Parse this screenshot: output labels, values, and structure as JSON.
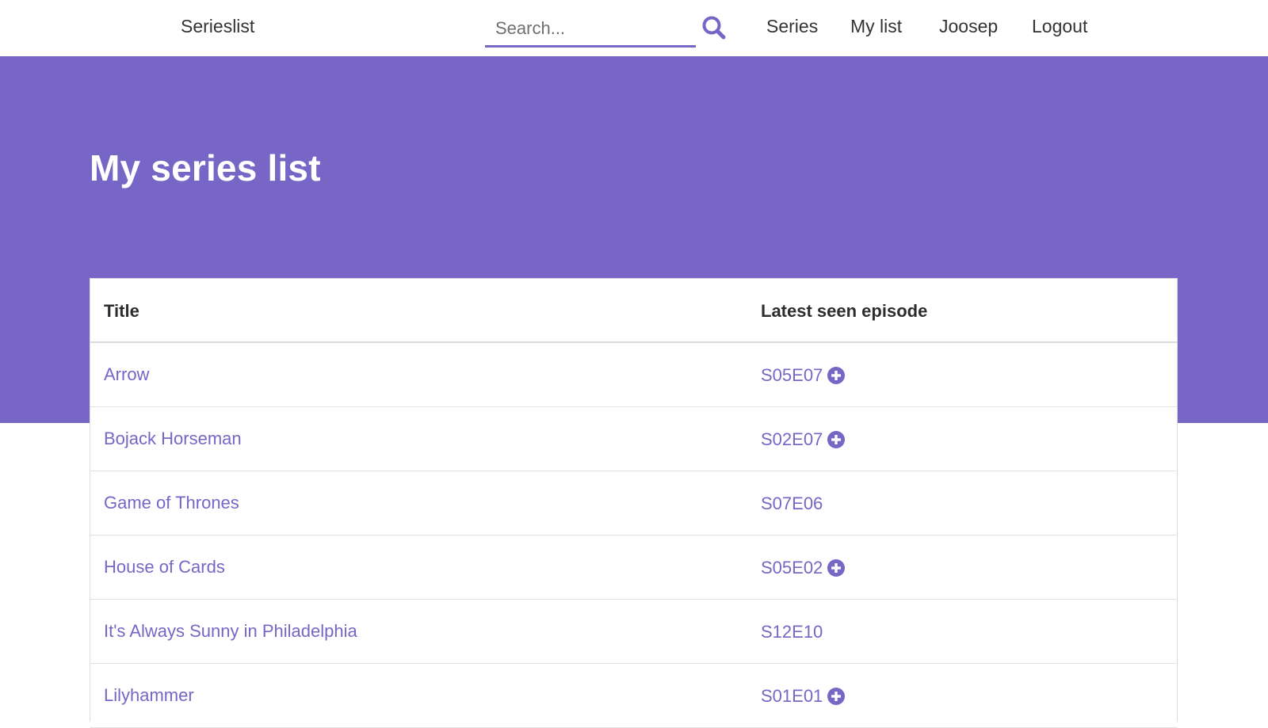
{
  "nav": {
    "brand": "Serieslist",
    "search_placeholder": "Search...",
    "search_value": "",
    "links": [
      {
        "label": "Series"
      },
      {
        "label": "My list"
      },
      {
        "label": "Joosep"
      },
      {
        "label": "Logout"
      }
    ]
  },
  "hero": {
    "title": "My series list"
  },
  "table": {
    "headers": {
      "title": "Title",
      "episode": "Latest seen episode"
    },
    "rows": [
      {
        "title": "Arrow",
        "episode": "S05E07",
        "has_add": true
      },
      {
        "title": "Bojack Horseman",
        "episode": "S02E07",
        "has_add": true
      },
      {
        "title": "Game of Thrones",
        "episode": "S07E06",
        "has_add": false
      },
      {
        "title": "House of Cards",
        "episode": "S05E02",
        "has_add": true
      },
      {
        "title": "It's Always Sunny in Philadelphia",
        "episode": "S12E10",
        "has_add": false
      },
      {
        "title": "Lilyhammer",
        "episode": "S01E01",
        "has_add": true
      }
    ]
  },
  "colors": {
    "accent": "#7766c6",
    "text": "#333333",
    "background": "#ffffff"
  },
  "icons": {
    "search": "search-icon",
    "add": "plus-circle-icon"
  }
}
